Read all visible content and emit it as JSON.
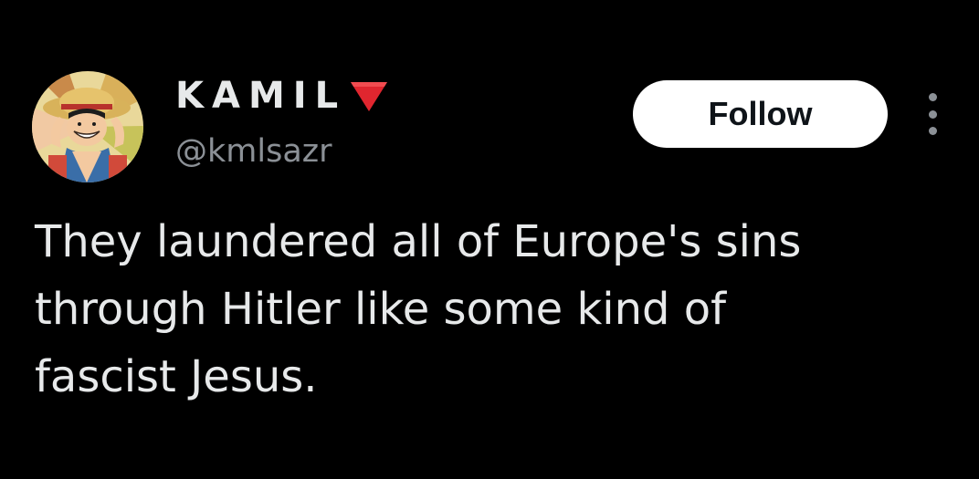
{
  "user": {
    "display_name": "KAMIL",
    "name_emoji": "red-triangle-pointed-down-icon",
    "handle": "@kmlsazr",
    "avatar": "avatar-anime-character-straw-hat"
  },
  "actions": {
    "follow_label": "Follow",
    "more_icon": "more-vertical-icon"
  },
  "tweet": {
    "lines": [
      "They laundered all of Europe's sins",
      "through Hitler like some kind of",
      "fascist Jesus."
    ]
  },
  "colors": {
    "background": "#000000",
    "primary_text": "#e7e9ea",
    "secondary_text": "#8b9096",
    "follow_button_bg": "#ffffff",
    "follow_button_text": "#0f1419",
    "flag_red": "#e0262f"
  }
}
